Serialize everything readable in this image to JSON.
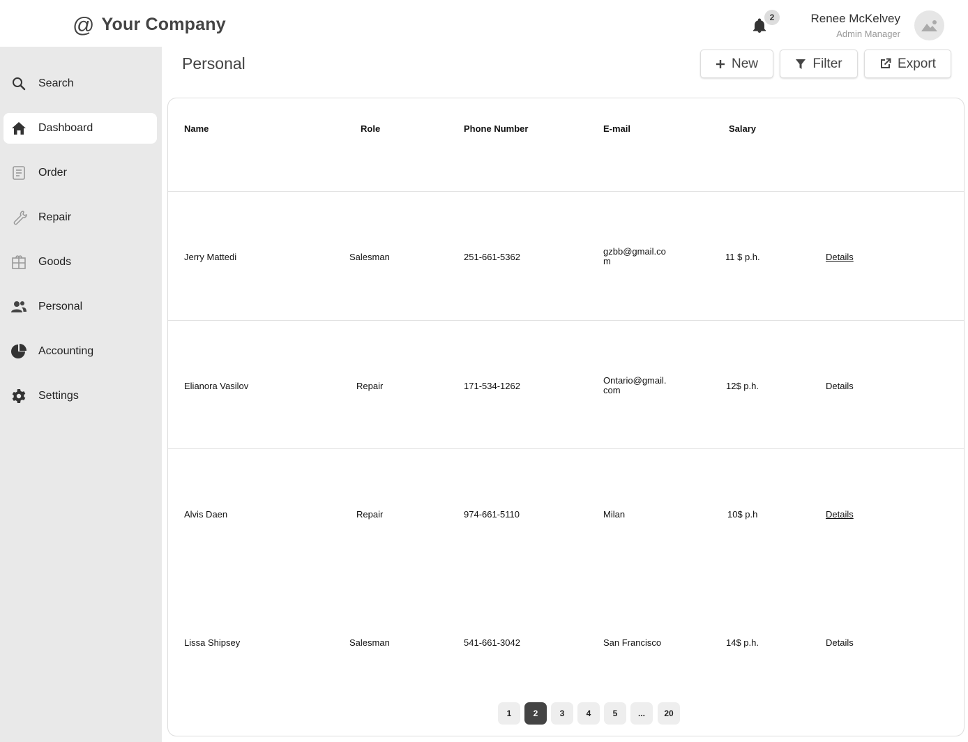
{
  "app": {
    "logo_mark": "@",
    "company": "Your Company",
    "notifications_count": "2",
    "user_name": "Renee McKelvey",
    "user_role": "Admin Manager"
  },
  "sidebar": {
    "items": [
      {
        "label": "Search",
        "icon": "search-icon"
      },
      {
        "label": "Dashboard",
        "icon": "home-icon"
      },
      {
        "label": "Order",
        "icon": "order-icon"
      },
      {
        "label": "Repair",
        "icon": "wrench-icon"
      },
      {
        "label": "Goods",
        "icon": "goods-icon"
      },
      {
        "label": "Personal",
        "icon": "people-icon"
      },
      {
        "label": "Accounting",
        "icon": "pie-chart-icon"
      },
      {
        "label": "Settings",
        "icon": "gear-icon"
      }
    ],
    "active": "Dashboard"
  },
  "main": {
    "title": "Personal",
    "buttons": {
      "new": "New",
      "filter": "Filter",
      "export": "Export"
    },
    "table": {
      "headers": [
        "Name",
        "Role",
        "Phone Number",
        "E-mail",
        "Salary"
      ],
      "rows": [
        {
          "name": "Jerry Mattedi",
          "role": "Salesman",
          "phone": "251-661-5362",
          "email_1": "gzbb@gmail.co",
          "email_2": "m",
          "salary": "11 $ p.h.",
          "details": "Details"
        },
        {
          "name": "Elianora Vasilov",
          "role": "Repair",
          "phone": "171-534-1262",
          "email_1": "Ontario@gmail.",
          "email_2": "com",
          "salary": "12$ p.h.",
          "details": "Details"
        },
        {
          "name": "Alvis Daen",
          "role": "Repair",
          "phone": "974-661-5110",
          "email_1": "Milan",
          "email_2": "",
          "salary": "10$ p.h",
          "details": "Details"
        },
        {
          "name": "Lissa Shipsey",
          "role": "Salesman",
          "phone": "541-661-3042",
          "email_1": "San Francisco",
          "email_2": "",
          "salary": "14$ p.h.",
          "details": "Details"
        }
      ]
    },
    "pagination": {
      "pages": [
        "1",
        "2",
        "3",
        "4",
        "5",
        "...",
        "20"
      ],
      "current": "2"
    }
  }
}
